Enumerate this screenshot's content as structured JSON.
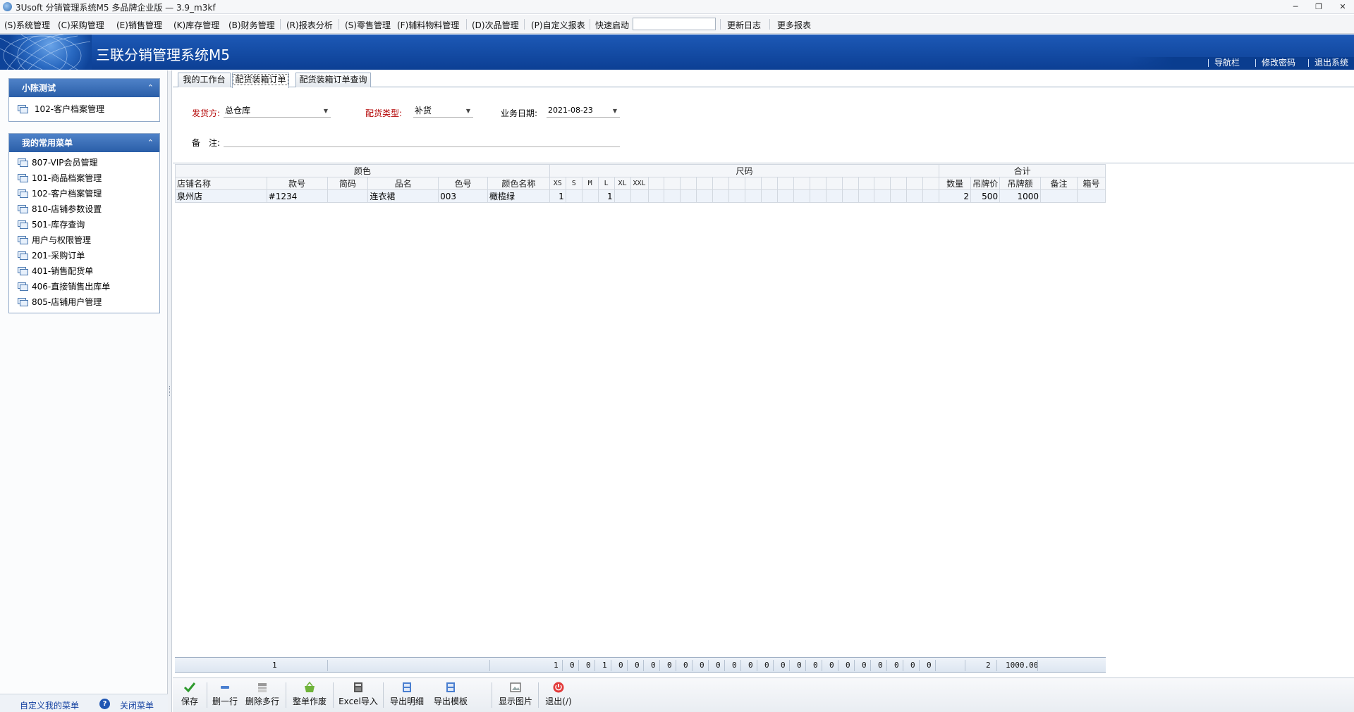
{
  "window": {
    "title": "3Usoft 分销管理系统M5 多品牌企业版 — 3.9_m3kf",
    "controls": [
      "minimize-icon",
      "restore-icon",
      "close-icon"
    ]
  },
  "menubar": {
    "items": [
      {
        "label": "(S)系统管理"
      },
      {
        "label": "(C)采购管理"
      },
      {
        "label": "(E)销售管理"
      },
      {
        "label": "(K)库存管理"
      },
      {
        "label": "(B)财务管理"
      },
      {
        "label": "(R)报表分析"
      },
      {
        "label": "(S)零售管理"
      },
      {
        "label": "(F)辅料物料管理"
      },
      {
        "label": "(D)次品管理"
      },
      {
        "label": "(P)自定义报表"
      }
    ],
    "quick_launch_label": "快速启动",
    "quick_launch_value": "",
    "update_log": "更新日志",
    "more_reports": "更多报表"
  },
  "banner": {
    "system_title": "三联分销管理系统M5",
    "links": [
      "导航栏",
      "修改密码",
      "退出系统"
    ]
  },
  "sidebar": {
    "panels": [
      {
        "title": "小陈测试",
        "items": [
          "102-客户档案管理"
        ]
      },
      {
        "title": "我的常用菜单",
        "items": [
          "807-VIP会员管理",
          "101-商品档案管理",
          "102-客户档案管理",
          "810-店铺参数设置",
          "501-库存查询",
          "用户与权限管理",
          "201-采购订单",
          "401-销售配货单",
          "406-直接销售出库单",
          "805-店铺用户管理"
        ]
      }
    ],
    "footer": {
      "customize_menu": "自定义我的菜单",
      "close_menu": "关闭菜单"
    }
  },
  "tabs": [
    {
      "label": "我的工作台",
      "active": false
    },
    {
      "label": "配货装箱订单",
      "active": true
    },
    {
      "label": "配货装箱订单查询",
      "active": false
    }
  ],
  "form": {
    "shipper_label": "发货方:",
    "shipper_value": "总仓库",
    "type_label": "配货类型:",
    "type_value": "补货",
    "date_label": "业务日期:",
    "date_value": "2021-08-23",
    "remark_label": "备　注:",
    "remark_value": ""
  },
  "grid": {
    "groups": {
      "color": "颜色",
      "size": "尺码",
      "total": "合计"
    },
    "columns": [
      "店铺名称",
      "款号",
      "简码",
      "品名",
      "色号",
      "颜色名称"
    ],
    "size_columns": [
      "XS",
      "S",
      "M",
      "L",
      "XL",
      "XXL"
    ],
    "total_columns": [
      "数量",
      "吊牌价",
      "吊牌额",
      "备注",
      "箱号"
    ],
    "rows": [
      {
        "store": "泉州店",
        "style_no": "#1234",
        "short_code": "",
        "product_name": "连衣裙",
        "color_code": "003",
        "color_name": "橄榄绿",
        "sizes": [
          "1",
          "",
          "",
          "1",
          "",
          ""
        ],
        "qty": "2",
        "tag_price": "500",
        "tag_amount": "1000",
        "remark": "",
        "box_no": ""
      }
    ],
    "totals": {
      "row_count": "1",
      "size_totals": [
        "1",
        "0",
        "0",
        "1",
        "0",
        "0",
        "0",
        "0",
        "0",
        "0",
        "0",
        "0",
        "0",
        "0",
        "0",
        "0",
        "0",
        "0",
        "0",
        "0",
        "0",
        "0",
        "0",
        "0"
      ],
      "qty": "2",
      "amount": "1000.00"
    }
  },
  "toolbar": {
    "buttons": [
      {
        "label": "保存",
        "icon": "checkmark-icon"
      },
      {
        "label": "删一行",
        "icon": "minus-icon"
      },
      {
        "label": "删除多行",
        "icon": "delete-rows-icon"
      },
      {
        "label": "整单作废",
        "icon": "basket-icon"
      },
      {
        "label": "Excel导入",
        "icon": "excel-import-icon"
      },
      {
        "label": "导出明细",
        "icon": "export-detail-icon"
      },
      {
        "label": "导出模板",
        "icon": "export-template-icon"
      },
      {
        "label": "显示图片",
        "icon": "picture-icon"
      },
      {
        "label": "退出(/)",
        "icon": "power-icon"
      }
    ]
  },
  "colors": {
    "banner": "#1d59b6",
    "panel_header": "#2a5ea8",
    "required_label": "#b30000"
  }
}
